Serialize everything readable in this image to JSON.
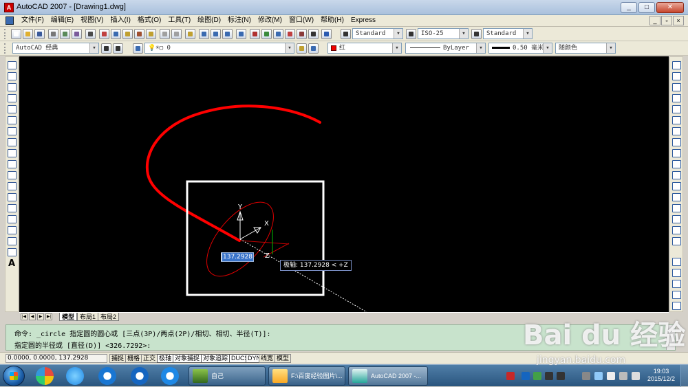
{
  "window": {
    "title": "AutoCAD 2007 - [Drawing1.dwg]",
    "controls": [
      "_",
      "□",
      "✕"
    ],
    "mdi_controls": [
      "_",
      "▫",
      "×"
    ]
  },
  "menu": [
    "文件(F)",
    "编辑(E)",
    "视图(V)",
    "插入(I)",
    "格式(O)",
    "工具(T)",
    "绘图(D)",
    "标注(N)",
    "修改(M)",
    "窗口(W)",
    "帮助(H)",
    "Express"
  ],
  "toolbar1": {
    "text_style": "Standard",
    "dim_style": "ISO-25",
    "table_style": "Standard"
  },
  "toolbar2": {
    "workspace": "AutoCAD 经典",
    "layer": "0",
    "color": "红",
    "linetype": "ByLayer",
    "lineweight": "0.50 毫米",
    "plotstyle": "随颜色"
  },
  "left_tools": [
    "line-icon",
    "construction-line-icon",
    "polyline-icon",
    "polygon-icon",
    "rectangle-icon",
    "arc-icon",
    "circle-icon",
    "revision-cloud-icon",
    "spline-icon",
    "ellipse-icon",
    "ellipse-arc-icon",
    "insert-block-icon",
    "make-block-icon",
    "point-icon",
    "hatch-icon",
    "gradient-icon",
    "region-icon",
    "table-icon",
    "mtext-icon"
  ],
  "right_tools": [
    "erase-icon",
    "copy-icon",
    "mirror-icon",
    "offset-icon",
    "array-icon",
    "move-icon",
    "rotate-icon",
    "scale-icon",
    "stretch-icon",
    "trim-icon",
    "extend-icon",
    "break-point-icon",
    "break-icon",
    "join-icon",
    "chamfer-icon",
    "fillet-icon",
    "explode-icon"
  ],
  "right_tools_lower": [
    "draw-order-icon",
    "bring-front-icon",
    "send-back-icon",
    "draw-order-above-icon",
    "draw-order-below-icon"
  ],
  "mtext_letter": "A",
  "canvas": {
    "dynamic_input_value": "137.2928",
    "polar_tooltip": "极轴: 137.2928 < +Z",
    "ucs_labels": [
      "Y",
      "X",
      "Z"
    ],
    "curve_color": "#ff0000",
    "ellipse_color": "#ff0000",
    "highlight_box_color": "#ffffff"
  },
  "layout_tabs": [
    "模型",
    "布局1",
    "布局2"
  ],
  "command": {
    "line1": "命令: _circle 指定圆的圆心或 [三点(3P)/两点(2P)/相切、相切、半径(T)]:",
    "line2": "指定圆的半径或 [直径(D)] <326.7292>:"
  },
  "status": {
    "coords": "0.0000, 0.0000, 137.2928",
    "buttons": [
      "捕捉",
      "栅格",
      "正交",
      "极轴",
      "对象捕捉",
      "对象追踪",
      "DUCS",
      "DYN",
      "线宽",
      "模型"
    ]
  },
  "taskbar": {
    "tasks": [
      "自己",
      "F:\\百度经验图片\\...",
      "AutoCAD 2007 -..."
    ],
    "time": "19:03",
    "date": "2015/12/2"
  },
  "watermark": {
    "brand": "Bai du 经验",
    "url": "jingyan.baidu.com"
  }
}
